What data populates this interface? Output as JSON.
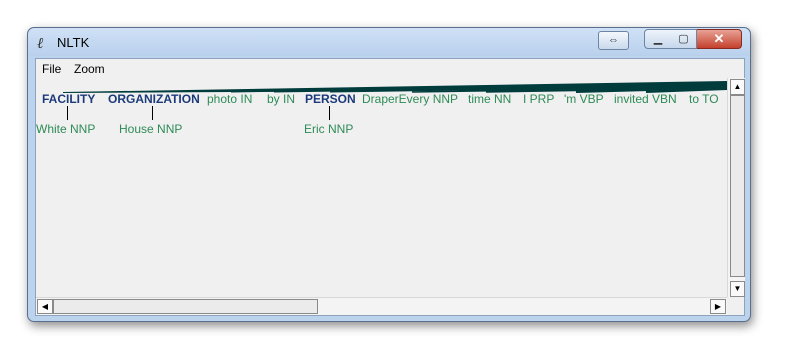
{
  "window": {
    "title": "NLTK"
  },
  "menubar": {
    "items": [
      "File",
      "Zoom"
    ]
  },
  "tree": {
    "top_row": [
      {
        "text": "FACILITY",
        "kind": "node"
      },
      {
        "text": "ORGANIZATION",
        "kind": "node"
      },
      {
        "text": "photo IN",
        "kind": "leaf"
      },
      {
        "text": "by IN",
        "kind": "leaf"
      },
      {
        "text": "PERSON",
        "kind": "node"
      },
      {
        "text": "DraperEvery NNP",
        "kind": "leaf"
      },
      {
        "text": "time NN",
        "kind": "leaf"
      },
      {
        "text": "I PRP",
        "kind": "leaf"
      },
      {
        "text": "'m VBP",
        "kind": "leaf"
      },
      {
        "text": "invited VBN",
        "kind": "leaf"
      },
      {
        "text": "to TO",
        "kind": "leaf"
      }
    ],
    "children": [
      {
        "text": "White NNP"
      },
      {
        "text": "House NNP"
      },
      {
        "text": "Eric NNP"
      }
    ]
  },
  "colors": {
    "node": "#1c3a7a",
    "leaf": "#2e8b57",
    "edge": "#003c3c"
  }
}
